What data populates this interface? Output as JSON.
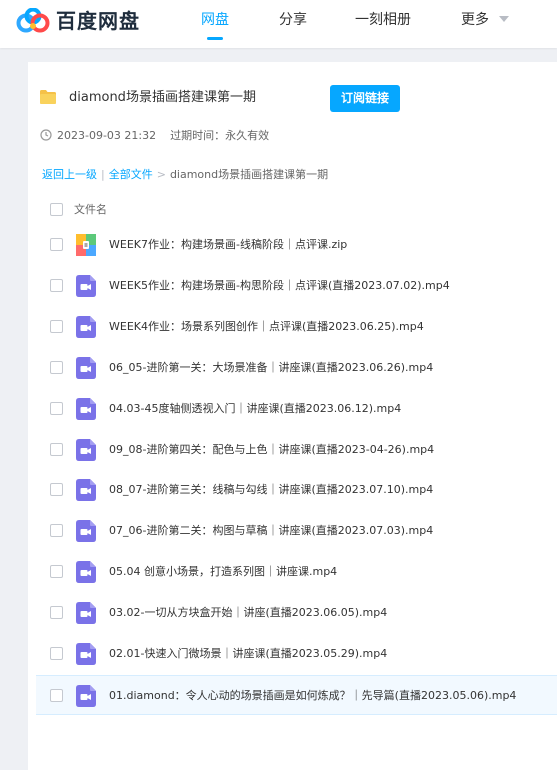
{
  "header": {
    "logo_text": "百度网盘",
    "nav": [
      "网盘",
      "分享",
      "一刻相册",
      "更多"
    ],
    "active_nav": "网盘"
  },
  "share": {
    "title": "diamond场景插画搭建课第一期",
    "subscribe_label": "订阅链接",
    "created_at": "2023-09-03 21:32",
    "expire_text": "过期时间：永久有效"
  },
  "breadcrumb": {
    "back": "返回上一级",
    "sep1": "|",
    "all_files": "全部文件",
    "sep2": ">",
    "current": "diamond场景插画搭建课第一期"
  },
  "table": {
    "column_header": "文件名",
    "files": [
      {
        "name": "WEEK7作业：构建场景画-线稿阶段｜点评课.zip",
        "type": "zip"
      },
      {
        "name": "WEEK5作业：构建场景画-构思阶段｜点评课(直播2023.07.02).mp4",
        "type": "video"
      },
      {
        "name": "WEEK4作业：场景系列图创作｜点评课(直播2023.06.25).mp4",
        "type": "video"
      },
      {
        "name": "06_05-进阶第一关：大场景准备｜讲座课(直播2023.06.26).mp4",
        "type": "video"
      },
      {
        "name": "04.03-45度轴侧透视入门｜讲座课(直播2023.06.12).mp4",
        "type": "video"
      },
      {
        "name": "09_08-进阶第四关：配色与上色｜讲座课(直播2023-04-26).mp4",
        "type": "video"
      },
      {
        "name": "08_07-进阶第三关：线稿与勾线｜讲座课(直播2023.07.10).mp4",
        "type": "video"
      },
      {
        "name": "07_06-进阶第二关：构图与草稿｜讲座课(直播2023.07.03).mp4",
        "type": "video"
      },
      {
        "name": "05.04 创意小场景，打造系列图｜讲座课.mp4",
        "type": "video"
      },
      {
        "name": "03.02-一切从方块盒开始｜讲座(直播2023.06.05).mp4",
        "type": "video"
      },
      {
        "name": "02.01-快速入门微场景｜讲座课(直播2023.05.29).mp4",
        "type": "video"
      },
      {
        "name": "01.diamond：令人心动的场景插画是如何炼成？｜先导篇(直播2023.05.06).mp4",
        "type": "video"
      }
    ]
  },
  "colors": {
    "accent": "#06a7ff",
    "video_icon": "#7a72e8",
    "folder": "#f5c148",
    "background": "#eef0f4"
  },
  "icons": {
    "logo": "baidu-cloud-logo",
    "folder": "folder-icon",
    "clock": "clock-icon",
    "video": "video-file-icon",
    "zip": "zip-file-icon",
    "more": "chevron-down-icon"
  }
}
